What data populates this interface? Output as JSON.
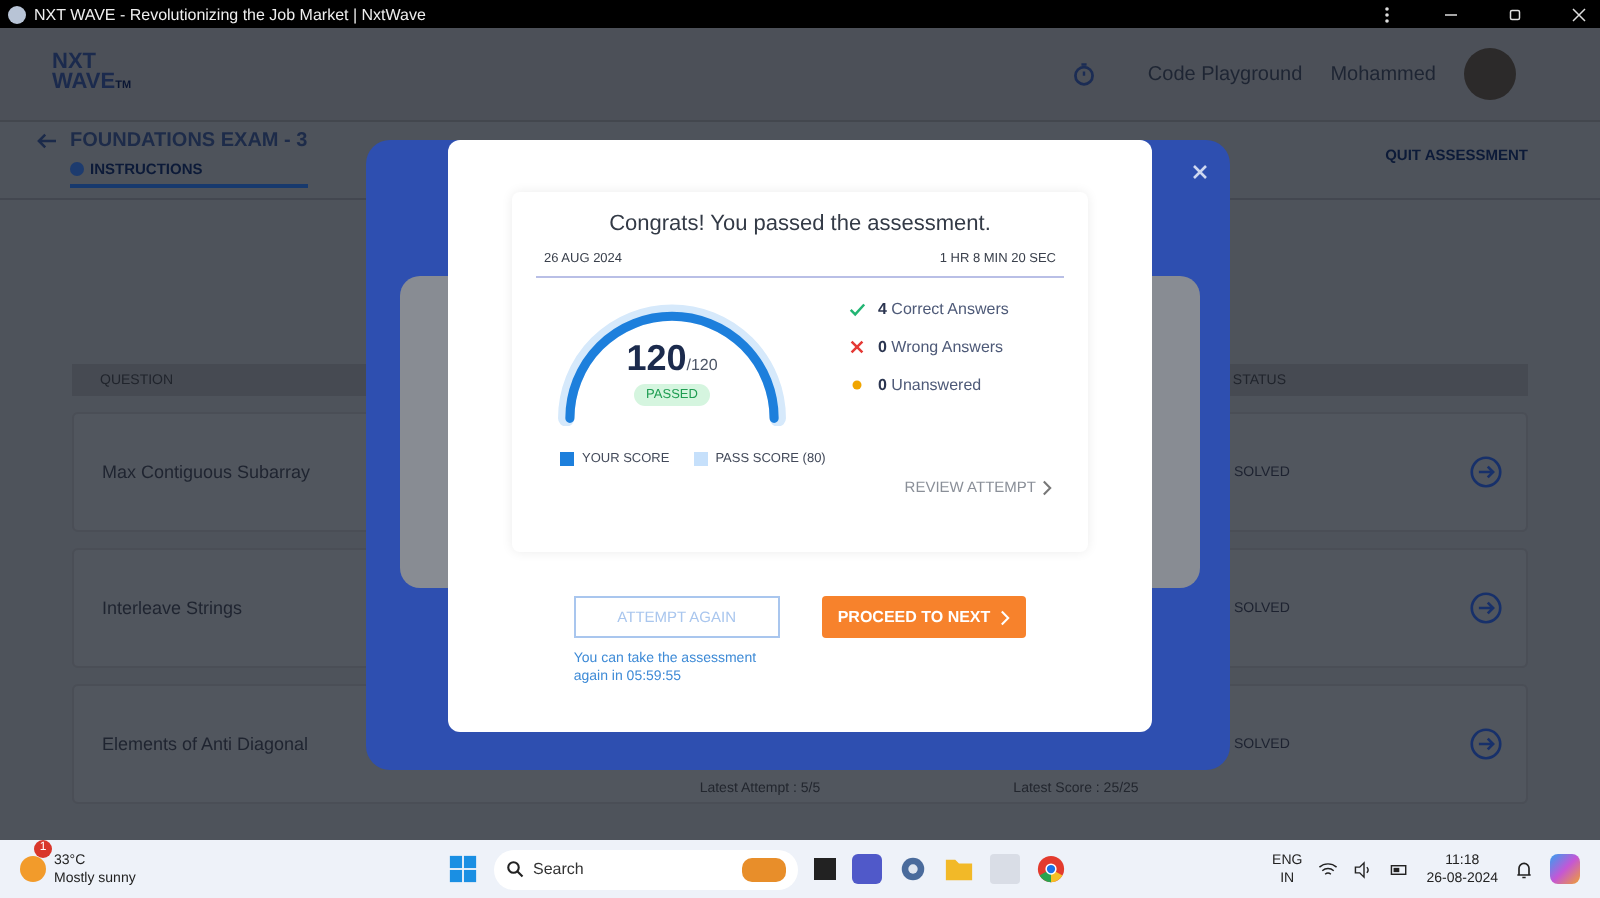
{
  "window": {
    "title": "NXT WAVE - Revolutionizing the Job Market | NxtWave"
  },
  "header": {
    "logo": [
      "NXT",
      "WAVE"
    ],
    "logo_mark": "TM",
    "code_playground": "Code Playground",
    "user": "Mohammed"
  },
  "exam": {
    "title": "FOUNDATIONS EXAM - 3",
    "tab": "INSTRUCTIONS",
    "quit": "QUIT ASSESSMENT"
  },
  "table": {
    "columns": [
      "QUESTION",
      "STATUS"
    ],
    "rows": [
      {
        "question": "Max Contiguous Subarray",
        "status": "SOLVED",
        "attempt": "",
        "score": ""
      },
      {
        "question": "Interleave Strings",
        "status": "SOLVED",
        "attempt": "",
        "score": ""
      },
      {
        "question": "Elements of Anti Diagonal",
        "status": "SOLVED",
        "attempt": "Latest Attempt : 5/5",
        "score": "Latest Score : 25/25"
      }
    ]
  },
  "modal": {
    "heading": "Congrats! You passed the assessment.",
    "date": "26 AUG 2024",
    "duration": "1 HR 8 MIN 20 SEC",
    "gauge": {
      "level": 1,
      "score": "120",
      "max": "/120",
      "badge": "PASSED"
    },
    "stats": [
      {
        "kind": "correct",
        "count": "4",
        "label": "Correct Answers"
      },
      {
        "kind": "wrong",
        "count": "0",
        "label": "Wrong Answers"
      },
      {
        "kind": "unanswered",
        "count": "0",
        "label": "Unanswered"
      }
    ],
    "legend": [
      {
        "label": "YOUR SCORE",
        "color": "#1d7fdc"
      },
      {
        "label": "PASS SCORE (80)",
        "color": "#c6e0fb"
      }
    ],
    "review": "REVIEW ATTEMPT",
    "attempt_again": {
      "label": "ATTEMPT AGAIN",
      "disabled": true
    },
    "proceed": "PROCEED TO NEXT",
    "note": "You can take the assessment again in 05:59:55"
  },
  "taskbar": {
    "temperature": "33°C",
    "weather": "Mostly sunny",
    "badge": "1",
    "search": "Search",
    "lang": [
      "ENG",
      "IN"
    ],
    "time": "11:18",
    "date": "26-08-2024"
  }
}
